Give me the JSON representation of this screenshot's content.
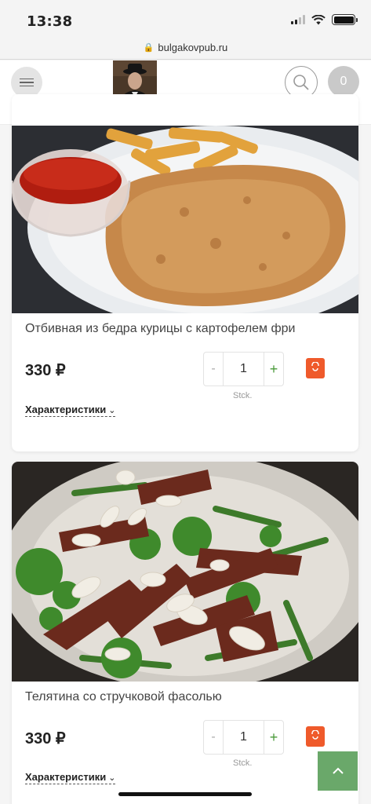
{
  "status": {
    "time": "13:38"
  },
  "browser": {
    "url": "bulgakovpub.ru"
  },
  "header": {
    "cart_count": "0"
  },
  "products": [
    {
      "title": "Отбивная из бедра курицы с картофелем фри",
      "price": "330 ₽",
      "quantity": "1",
      "minus": "-",
      "plus": "+",
      "unit": "Stck.",
      "specs_label": "Характеристики"
    },
    {
      "title": "Телятина со стручковой фасолью",
      "price": "330 ₽",
      "quantity": "1",
      "minus": "-",
      "plus": "+",
      "unit": "Stck.",
      "specs_label": "Характеристики"
    }
  ],
  "colors": {
    "accent_green": "#6aa86a",
    "cart_orange": "#ef5a2b"
  }
}
